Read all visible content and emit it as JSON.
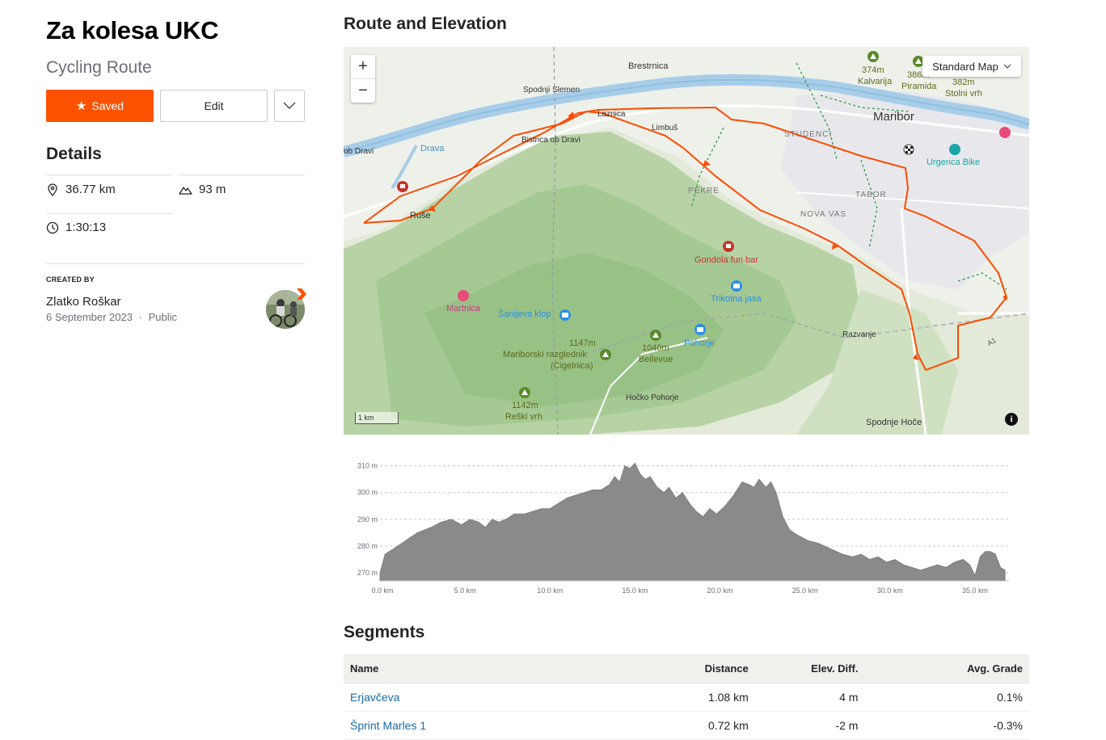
{
  "route": {
    "title": "Za kolesa UKC",
    "subtitle": "Cycling Route"
  },
  "actions": {
    "saved_label": "Saved",
    "edit_label": "Edit"
  },
  "details": {
    "heading": "Details",
    "distance": "36.77 km",
    "elevation_gain": "93 m",
    "est_time": "1:30:13"
  },
  "creator": {
    "label": "CREATED BY",
    "name": "Zlatko Roškar",
    "date": "6 September 2023",
    "visibility": "Public"
  },
  "map": {
    "heading": "Route and Elevation",
    "zoom_in": "+",
    "zoom_out": "−",
    "style": "Standard Map",
    "scale": "1 km",
    "info": "i",
    "route_color": "#fc4c02",
    "labels": {
      "brestrnica": "Brestrnica",
      "spodnji_slemen": "Spodnji Slemen",
      "laznica": "Laznica",
      "limbus": "Limbuš",
      "bistrica": "Bistrica ob Dravi",
      "ob_dravi": "ob Dravi",
      "drava": "Drava",
      "ruse": "Ruše",
      "pekre": "PEKRE",
      "studenci": "STUDENCI",
      "maribor": "Maribor",
      "tabor": "TABOR",
      "nova_vas": "NOVA VAS",
      "kalvarija_h": "374m",
      "kalvarija": "Kalvarija",
      "piramida_h": "386m",
      "piramida": "Piramida",
      "stolni_h": "382m",
      "stolni": "Stolni vrh",
      "urgenca": "Urgenca Bike",
      "gondola": "Gondola fun bar",
      "trikotna": "Trikotna jasa",
      "martnica": "Martnica",
      "sanijeva": "Šanijeva klop",
      "razgl_h": "1147m",
      "razgl_1": "Mariborski razglednik",
      "razgl_2": "(Cigelnica)",
      "bellevue_h": "1040m",
      "bellevue": "Bellevue",
      "pohorje": "Pohorje",
      "razvanje": "Razvanje",
      "reski_h": "1142m",
      "reski": "Reški vrh",
      "hocko": "Hočko Pohorje",
      "spodnje_hoce": "Spodnje Hoče",
      "a1": "A1"
    }
  },
  "chart_data": {
    "type": "area",
    "title": "",
    "xlabel": "",
    "ylabel": "",
    "x_unit": "km",
    "y_unit": "m",
    "xlim": [
      0,
      37
    ],
    "ylim": [
      267,
      312
    ],
    "x_ticks": [
      "0.0 km",
      "5.0 km",
      "10.0 km",
      "15.0 km",
      "20.0 km",
      "25.0 km",
      "30.0 km",
      "35.0 km"
    ],
    "y_ticks": [
      "310 m",
      "300 m",
      "290 m",
      "280 m",
      "270 m"
    ],
    "grid": true,
    "fill_color": "#8a8a8a",
    "x": [
      0,
      0.3,
      0.8,
      1.5,
      2.2,
      3.0,
      3.6,
      4.2,
      4.8,
      5.3,
      5.8,
      6.2,
      6.6,
      7.0,
      7.4,
      7.9,
      8.5,
      9.0,
      9.5,
      10.0,
      10.5,
      11.0,
      11.5,
      12.0,
      12.5,
      13.0,
      13.5,
      13.8,
      14.1,
      14.4,
      14.7,
      15.0,
      15.3,
      15.6,
      15.9,
      16.3,
      16.7,
      17.0,
      17.4,
      17.8,
      18.2,
      18.6,
      19.0,
      19.4,
      19.8,
      20.3,
      20.8,
      21.3,
      21.7,
      22.0,
      22.3,
      22.7,
      23.0,
      23.3,
      23.7,
      24.1,
      24.6,
      25.2,
      25.8,
      26.5,
      27.2,
      27.8,
      28.3,
      28.8,
      29.3,
      29.8,
      30.3,
      30.8,
      31.3,
      31.8,
      32.3,
      32.8,
      33.3,
      33.8,
      34.3,
      34.7,
      35.0,
      35.3,
      35.6,
      35.9,
      36.2,
      36.5,
      36.77
    ],
    "y": [
      270,
      277,
      279,
      282,
      285,
      287,
      289,
      290,
      288,
      290,
      289,
      287,
      290,
      289,
      290,
      292,
      292,
      293,
      294,
      294,
      296,
      298,
      299,
      300,
      301,
      301,
      303,
      306,
      304,
      310,
      309,
      311,
      307,
      305,
      306,
      302,
      300,
      302,
      298,
      300,
      296,
      293,
      291,
      294,
      292,
      295,
      299,
      304,
      303,
      302,
      305,
      302,
      304,
      300,
      291,
      286,
      284,
      282,
      281,
      279,
      277,
      276,
      277,
      275,
      276,
      274,
      275,
      273,
      272,
      271,
      272,
      273,
      272,
      274,
      275,
      273,
      269,
      276,
      278,
      278,
      277,
      272,
      271
    ]
  },
  "segments": {
    "heading": "Segments",
    "columns": [
      "Name",
      "Distance",
      "Elev. Diff.",
      "Avg. Grade"
    ],
    "rows": [
      {
        "name": "Erjavčeva",
        "distance": "1.08 km",
        "elev": "4 m",
        "grade": "0.1%"
      },
      {
        "name": "Šprint Marles 1",
        "distance": "0.72 km",
        "elev": "-2 m",
        "grade": "-0.3%"
      }
    ]
  }
}
